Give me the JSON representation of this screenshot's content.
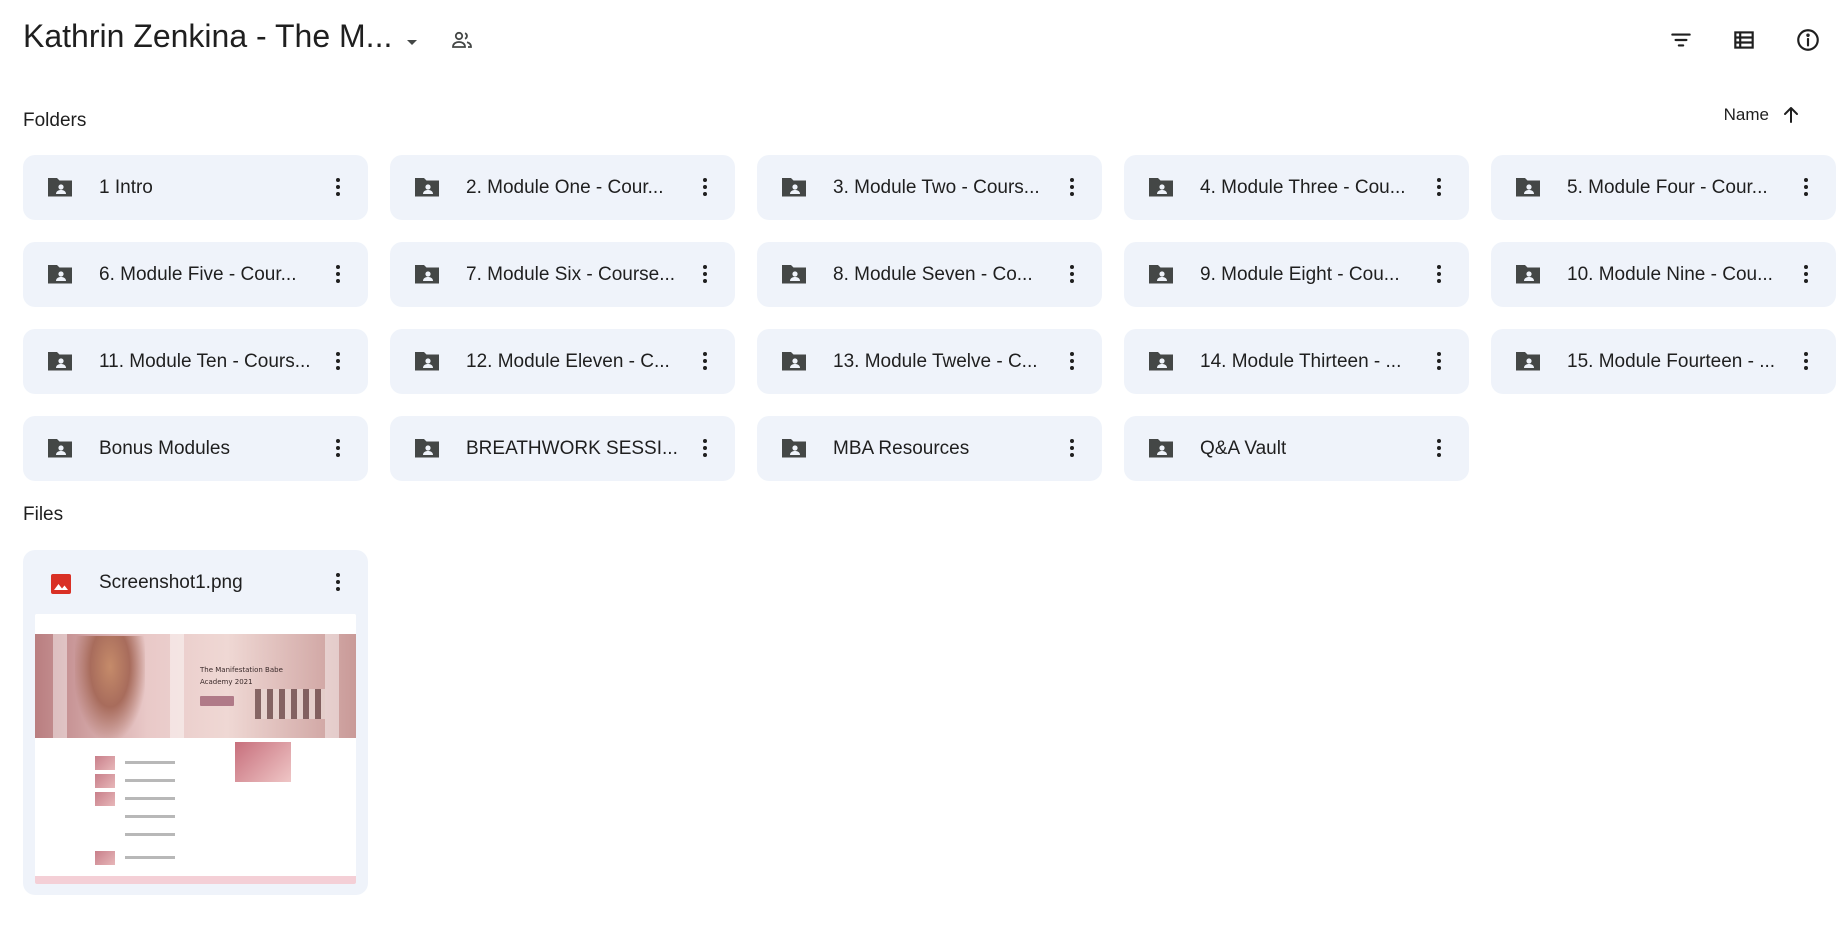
{
  "header": {
    "title": "Kathrin Zenkina - The M...",
    "caret_icon": "arrow-drop-down-icon",
    "shared_icon": "people-icon",
    "tools": [
      {
        "name": "filter",
        "icon": "filter-icon"
      },
      {
        "name": "list-view",
        "icon": "list-view-icon"
      },
      {
        "name": "details",
        "icon": "info-icon"
      }
    ]
  },
  "folders_section": {
    "label": "Folders",
    "sort_label": "Name",
    "sort_icon": "arrow-up-icon",
    "items": [
      {
        "name": "1 Intro"
      },
      {
        "name": "2. Module One - Cour..."
      },
      {
        "name": "3. Module Two - Cours..."
      },
      {
        "name": "4. Module Three - Cou..."
      },
      {
        "name": "5. Module Four - Cour..."
      },
      {
        "name": "6. Module Five - Cour..."
      },
      {
        "name": "7. Module Six - Course..."
      },
      {
        "name": "8. Module Seven - Co..."
      },
      {
        "name": "9. Module Eight - Cou..."
      },
      {
        "name": "10. Module Nine - Cou..."
      },
      {
        "name": "11. Module Ten - Cours..."
      },
      {
        "name": "12. Module Eleven - C..."
      },
      {
        "name": "13. Module Twelve - C..."
      },
      {
        "name": "14. Module Thirteen - ..."
      },
      {
        "name": "15. Module Fourteen - ..."
      },
      {
        "name": "Bonus Modules"
      },
      {
        "name": "BREATHWORK SESSI..."
      },
      {
        "name": "MBA Resources"
      },
      {
        "name": "Q&A Vault"
      }
    ]
  },
  "files_section": {
    "label": "Files",
    "items": [
      {
        "name": "Screenshot1.png",
        "icon": "image-icon",
        "icon_color": "#d93025",
        "thumbnail": {
          "hero_text": "The Manifestation Babe Academy 2021"
        }
      }
    ]
  },
  "colors": {
    "card_bg": "#eff3fa",
    "icon_gray": "#444746",
    "text": "#1f1f1f"
  }
}
